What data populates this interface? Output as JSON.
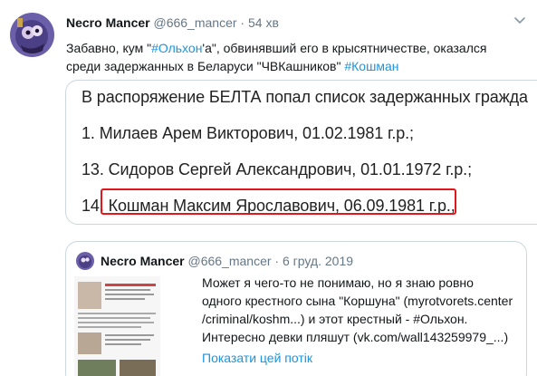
{
  "tweet": {
    "author_name": "Necro Mancer",
    "author_handle": "@666_mancer",
    "separator": "·",
    "time": "54 хв",
    "text_parts": {
      "p1": "Забавно, кум \"",
      "hashtag1": "#Ольхон",
      "p2": "'а\", обвинявший его в крысятничестве, оказался",
      "p3": "среди задержанных в Беларуси \"ЧВКашников\" ",
      "hashtag2": "#Кошман"
    }
  },
  "media": {
    "lines": [
      "В распоряжение БЕЛТА попал список задержанных гражда",
      "1. Милаев Арем Викторович, 01.02.1981 г.р.;",
      "13. Сидоров Сергей Александрович, 01.01.1972 г.р.;",
      "14. Кошман Максим Ярославович, 06.09.1981 г.р.,"
    ],
    "highlight_color": "#e3161c"
  },
  "quote": {
    "author_name": "Necro Mancer",
    "author_handle": "@666_mancer",
    "separator": "·",
    "date": "6 груд. 2019",
    "text_lines": [
      "Может я чего-то не понимаю, но я знаю ровно",
      "одного крестного сына \"Коршуна\" (myrotvorets.center",
      "/criminal/koshm...) и этот крестный - #Ольхон.",
      "Интересно девки пляшут (vk.com/wall143259979_...)"
    ],
    "show_thread": "Показати цей потік"
  },
  "icons": {
    "avatar": "avatar-image",
    "caret": "chevron-down-icon"
  },
  "colors": {
    "link": "#1b95e0",
    "secondary_text": "#657786",
    "border": "#ccd6dd"
  }
}
